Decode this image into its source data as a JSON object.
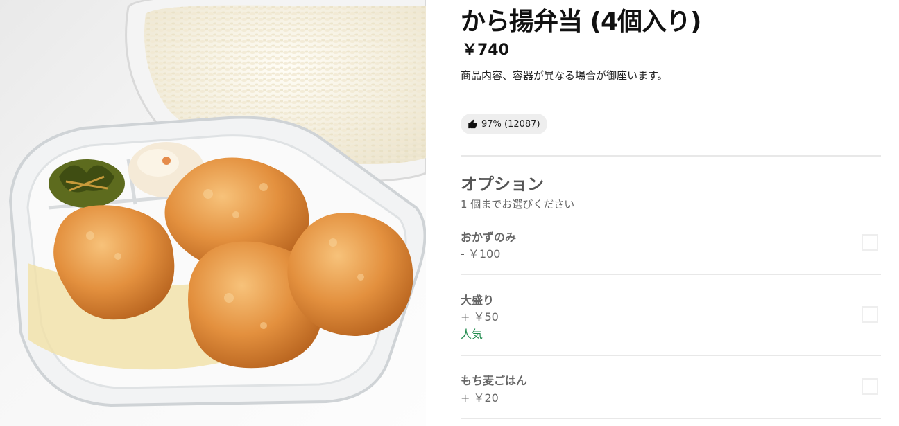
{
  "product": {
    "title": "から揚弁当 (4個入り)",
    "price": "￥740",
    "description": "商品内容、容器が異なる場合が御座います。",
    "rating": "97% (12087)"
  },
  "options": {
    "title": "オプション",
    "subtitle": "1 個までお選びください",
    "items": [
      {
        "name": "おかずのみ",
        "price": "- ￥100"
      },
      {
        "name": "大盛り",
        "price": "+ ￥50",
        "badge": "人気"
      },
      {
        "name": "もち麦ごはん",
        "price": "+ ￥20"
      }
    ]
  },
  "icons": {
    "rating": "thumbs-up-icon"
  },
  "colors": {
    "badge": "#1f8a4c",
    "text_muted": "#666666",
    "pill_bg": "#eeeeee",
    "divider": "#e8e8e8"
  }
}
